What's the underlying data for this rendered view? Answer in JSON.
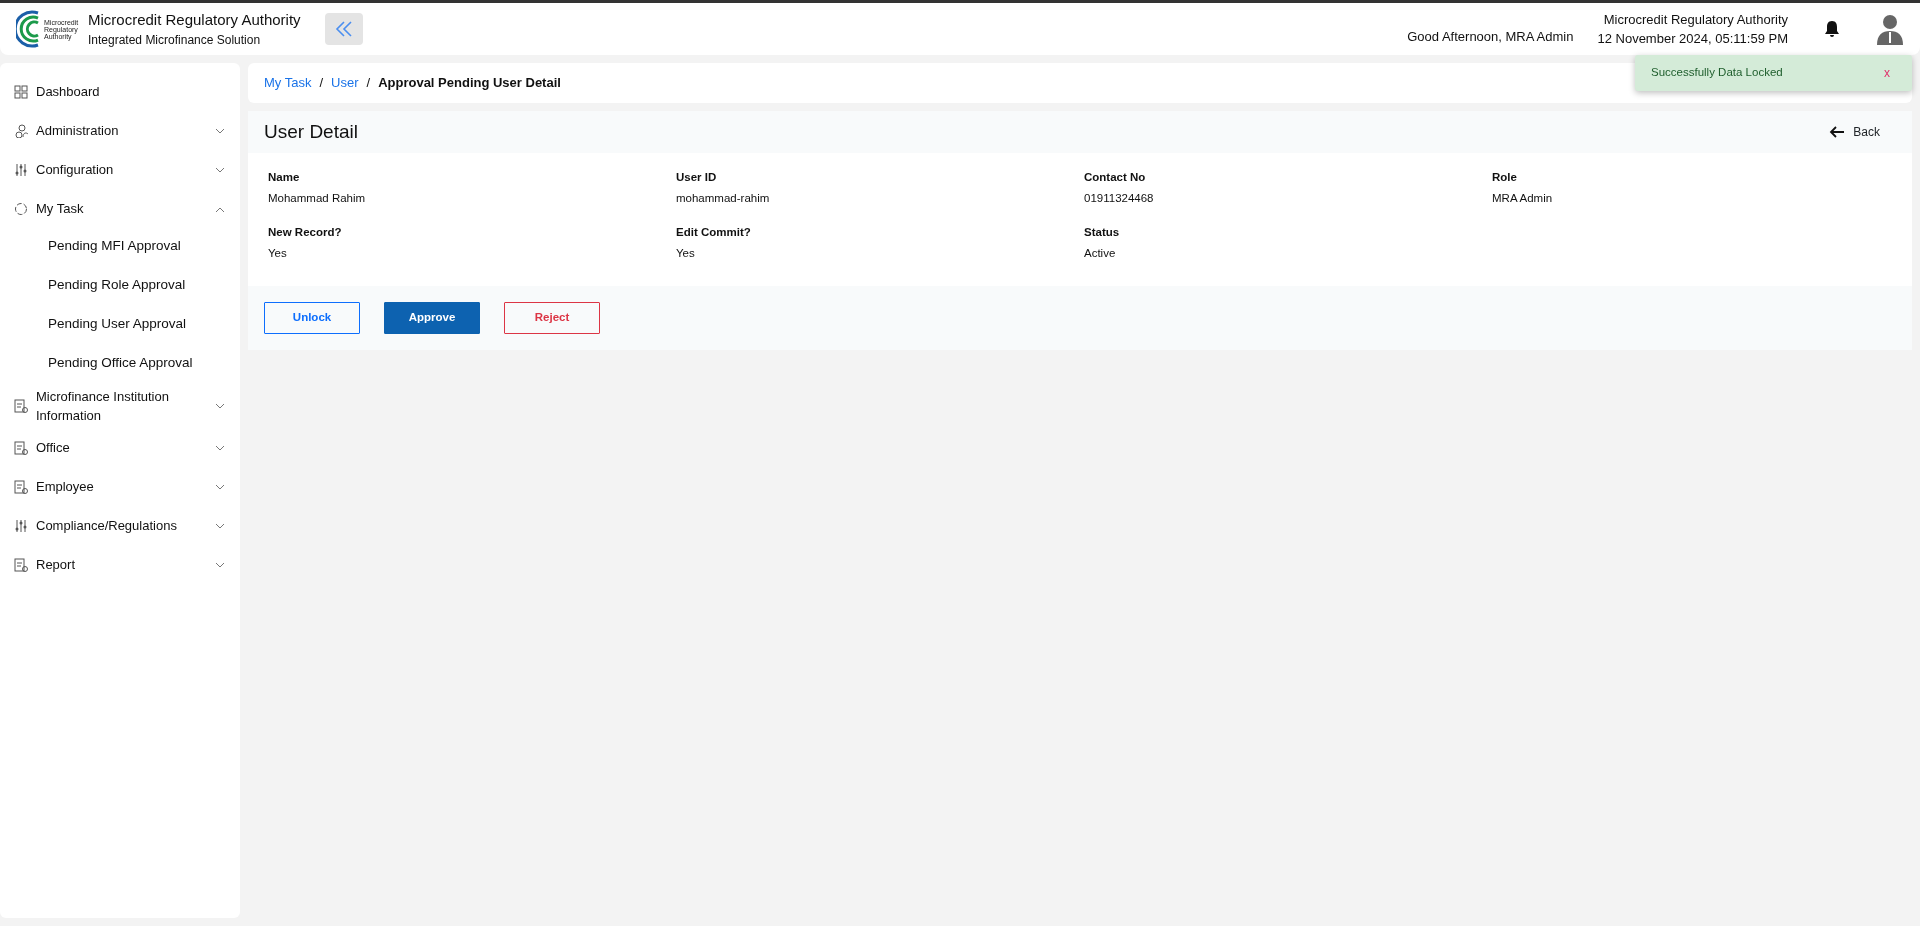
{
  "header": {
    "logo_text": "Microcredit Regulatory Authority",
    "title": "Microcredit Regulatory Authority",
    "subtitle": "Integrated Microfinance Solution",
    "greeting": "Good Afternoon, MRA Admin",
    "org": "Microcredit Regulatory Authority",
    "datetime": "12 November 2024, 05:11:59 PM"
  },
  "sidebar": {
    "items": [
      {
        "label": "Dashboard",
        "kind": "link"
      },
      {
        "label": "Administration",
        "kind": "group",
        "expanded": false
      },
      {
        "label": "Configuration",
        "kind": "group",
        "expanded": false
      },
      {
        "label": "My Task",
        "kind": "group",
        "expanded": true,
        "children": [
          {
            "label": "Pending MFI Approval"
          },
          {
            "label": "Pending Role Approval"
          },
          {
            "label": "Pending User Approval"
          },
          {
            "label": "Pending Office Approval"
          }
        ]
      },
      {
        "label": "Microfinance Institution Information",
        "kind": "group",
        "expanded": false
      },
      {
        "label": "Office",
        "kind": "group",
        "expanded": false
      },
      {
        "label": "Employee",
        "kind": "group",
        "expanded": false
      },
      {
        "label": "Compliance/Regulations",
        "kind": "group",
        "expanded": false
      },
      {
        "label": "Report",
        "kind": "group",
        "expanded": false
      }
    ]
  },
  "breadcrumb": [
    {
      "label": "My Task",
      "kind": "link"
    },
    {
      "separator": "/",
      "label": "User",
      "kind": "link"
    },
    {
      "separator": "/",
      "label": "Approval Pending User Detail",
      "kind": "current"
    }
  ],
  "detail": {
    "title": "User Detail",
    "back": "Back",
    "fields": [
      {
        "label": "Name",
        "value": "Mohammad Rahim"
      },
      {
        "label": "User ID",
        "value": "mohammad-rahim"
      },
      {
        "label": "Contact No",
        "value": "01911324468"
      },
      {
        "label": "Role",
        "value": "MRA Admin"
      },
      {
        "label": "New Record?",
        "value": "Yes"
      },
      {
        "label": "Edit Commit?",
        "value": "Yes"
      },
      {
        "label": "Status",
        "value": "Active"
      }
    ],
    "buttons": [
      {
        "label": "Unlock",
        "kind": "outline-primary"
      },
      {
        "label": "Approve",
        "kind": "primary"
      },
      {
        "label": "Reject",
        "kind": "outline-danger"
      }
    ]
  },
  "toast": {
    "message": "Successfully Data Locked",
    "close": "x"
  }
}
